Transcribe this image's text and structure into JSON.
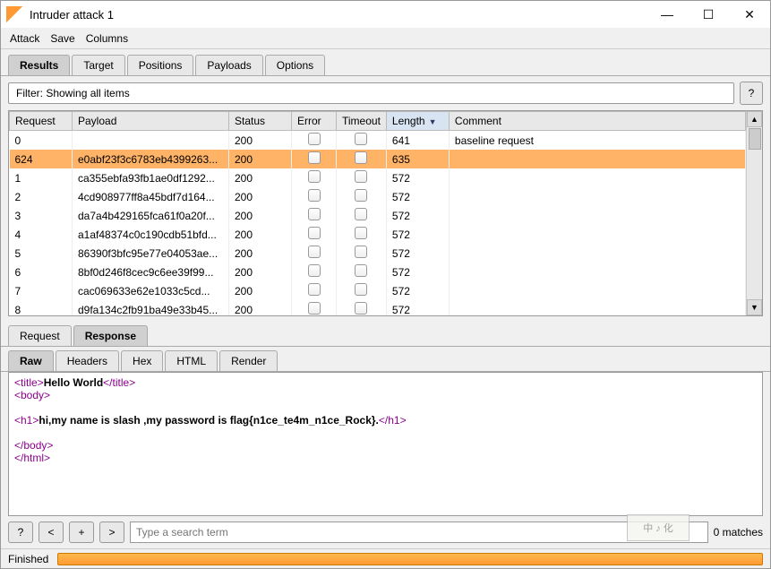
{
  "window": {
    "title": "Intruder attack 1"
  },
  "menu": {
    "attack": "Attack",
    "save": "Save",
    "columns": "Columns"
  },
  "tabs": {
    "results": "Results",
    "target": "Target",
    "positions": "Positions",
    "payloads": "Payloads",
    "options": "Options"
  },
  "filter": {
    "text": "Filter: Showing all items",
    "help": "?"
  },
  "columns": {
    "request": "Request",
    "payload": "Payload",
    "status": "Status",
    "error": "Error",
    "timeout": "Timeout",
    "length": "Length",
    "comment": "Comment"
  },
  "rows": [
    {
      "request": "0",
      "payload": "",
      "status": "200",
      "length": "641",
      "comment": "baseline request",
      "sel": false
    },
    {
      "request": "624",
      "payload": "e0abf23f3c6783eb4399263...",
      "status": "200",
      "length": "635",
      "comment": "",
      "sel": true
    },
    {
      "request": "1",
      "payload": "ca355ebfa93fb1ae0df1292...",
      "status": "200",
      "length": "572",
      "comment": "",
      "sel": false
    },
    {
      "request": "2",
      "payload": "4cd908977ff8a45bdf7d164...",
      "status": "200",
      "length": "572",
      "comment": "",
      "sel": false
    },
    {
      "request": "3",
      "payload": "da7a4b429165fca61f0a20f...",
      "status": "200",
      "length": "572",
      "comment": "",
      "sel": false
    },
    {
      "request": "4",
      "payload": "a1af48374c0c190cdb51bfd...",
      "status": "200",
      "length": "572",
      "comment": "",
      "sel": false
    },
    {
      "request": "5",
      "payload": "86390f3bfc95e77e04053ae...",
      "status": "200",
      "length": "572",
      "comment": "",
      "sel": false
    },
    {
      "request": "6",
      "payload": "8bf0d246f8cec9c6ee39f99...",
      "status": "200",
      "length": "572",
      "comment": "",
      "sel": false
    },
    {
      "request": "7",
      "payload": "cac069633e62e1033c5cd...",
      "status": "200",
      "length": "572",
      "comment": "",
      "sel": false
    },
    {
      "request": "8",
      "payload": "d9fa134c2fb91ba49e33b45...",
      "status": "200",
      "length": "572",
      "comment": "",
      "sel": false
    }
  ],
  "reqresp": {
    "request": "Request",
    "response": "Response"
  },
  "viewtabs": {
    "raw": "Raw",
    "headers": "Headers",
    "hex": "Hex",
    "html": "HTML",
    "render": "Render"
  },
  "raw": {
    "title_open": "<title>",
    "title_text": "Hello World",
    "title_close": "</title>",
    "body_open": "<body>",
    "h1_open": "<h1>",
    "h1_text": "hi,my name is slash ,my password is flag{n1ce_te4m_n1ce_Rock}.",
    "h1_close": "</h1>",
    "body_close": "</body>",
    "html_close": "</html>"
  },
  "search": {
    "help": "?",
    "prev": "<",
    "add": "+",
    "next": ">",
    "placeholder": "Type a search term",
    "matches": "0 matches"
  },
  "status": {
    "text": "Finished"
  },
  "watermark": "中 ♪ 化"
}
